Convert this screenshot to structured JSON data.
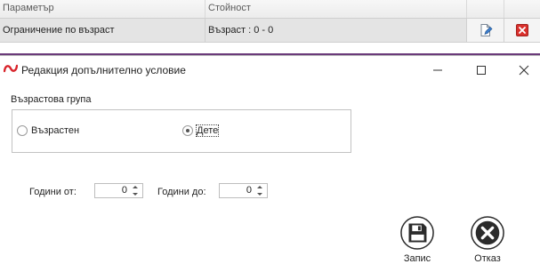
{
  "grid": {
    "columns": [
      "Параметър",
      "Стойност"
    ],
    "row": {
      "parameter": "Ограничение по възраст",
      "value": "Възраст : 0 - 0"
    }
  },
  "dialog": {
    "title": "Редакция допълнително условие",
    "group_label": "Възрастова група",
    "radios": [
      {
        "label": "Възрастен",
        "checked": false
      },
      {
        "label": "Дете",
        "checked": true
      }
    ],
    "years_from": {
      "label": "Години от:",
      "value": "0"
    },
    "years_to": {
      "label": "Години до:",
      "value": "0"
    },
    "save_label": "Запис",
    "cancel_label": "Отказ"
  },
  "colors": {
    "accent_line": "#6b3a7a",
    "logo_red": "#d8232a",
    "delete_red": "#d9302c"
  }
}
